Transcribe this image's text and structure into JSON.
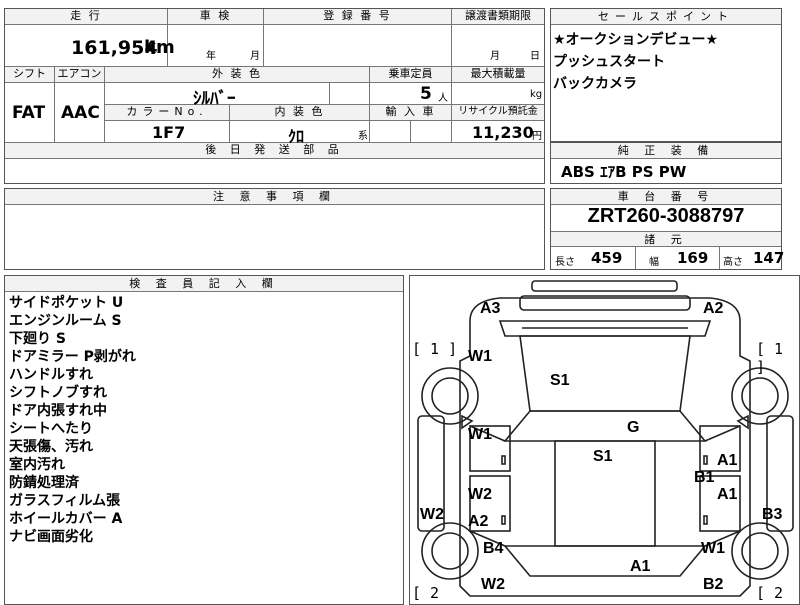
{
  "top_table": {
    "mileage_label": "走 行",
    "mileage_value": "161,954",
    "mileage_unit": "km",
    "inspection_label": "車 検",
    "inspection_year_unit": "年",
    "inspection_month_unit": "月",
    "reg_no_label": "登 録 番 号",
    "transfer_label": "譲渡書類期限",
    "transfer_month_unit": "月",
    "transfer_day_unit": "日",
    "shift_label": "シフト",
    "shift_value": "FAT",
    "ac_label": "エアコン",
    "ac_value": "AAC",
    "exterior_label": "外 装 色",
    "exterior_value": "ｼﾙﾊﾞｰ",
    "capacity_label": "乗車定員",
    "capacity_value": "5",
    "capacity_unit": "人",
    "max_load_label": "最大積載量",
    "max_load_unit": "kg",
    "color_no_label": "カラーNo.",
    "color_no_value": "1F7",
    "interior_label": "内 装 色",
    "interior_value": "ｸﾛ",
    "interior_unit": "系",
    "import_label": "輸 入 車",
    "recycle_label": "リサイクル預託金",
    "recycle_value": "11,230",
    "recycle_unit": "円",
    "later_parts_label": "後 日 発 送 部 品"
  },
  "sales_points": {
    "label": "セールスポイント",
    "items": [
      "★オークションデビュー★",
      "プッシュスタート",
      "バックカメラ"
    ]
  },
  "equipment": {
    "label": "純 正 装 備",
    "value": "ABS ｴｱB PS PW"
  },
  "notes": {
    "label": "注 意 事 項 欄"
  },
  "chassis": {
    "label": "車 台 番 号",
    "value": "ZRT260-3088797",
    "specs_label": "諸 元",
    "length_label": "長さ",
    "length_value": "459",
    "width_label": "幅",
    "width_value": "169",
    "height_label": "高さ",
    "height_value": "147"
  },
  "inspector": {
    "label": "検 査 員 記 入 欄",
    "items": [
      "サイドポケット U",
      "エンジンルーム S",
      "下廻り S",
      "ドアミラー P剥がれ",
      "ハンドルすれ",
      "シフトノブすれ",
      "ドア内張すれ中",
      "シートへたり",
      "天張傷、汚れ",
      "室内汚れ",
      "防錆処理済",
      "ガラスフィルム張",
      "ホイールカバー A",
      "ナビ画面劣化"
    ]
  },
  "diagram": {
    "bracket1_left": "[ 1 ]",
    "bracket1_right": "[ 1 ]",
    "bracket2_left": "[ 2",
    "bracket2_right": "[ 2 ]",
    "marks": {
      "a3": "A3",
      "a2_top": "A2",
      "w1_front_left": "W1",
      "s1_hood": "S1",
      "w1_door_left": "W1",
      "g_windshield": "G",
      "s1_roof": "S1",
      "a1_front_right": "A1",
      "b1_right": "B1",
      "w2_rear_door_left": "W2",
      "a1_rear_right": "A1",
      "w2_side": "W2",
      "a2_rear_left": "A2",
      "b3": "B3",
      "b4": "B4",
      "w1_rear_right": "W1",
      "a1_trunk": "A1",
      "w2_rear_left": "W2",
      "b2_rear_right": "B2"
    }
  }
}
